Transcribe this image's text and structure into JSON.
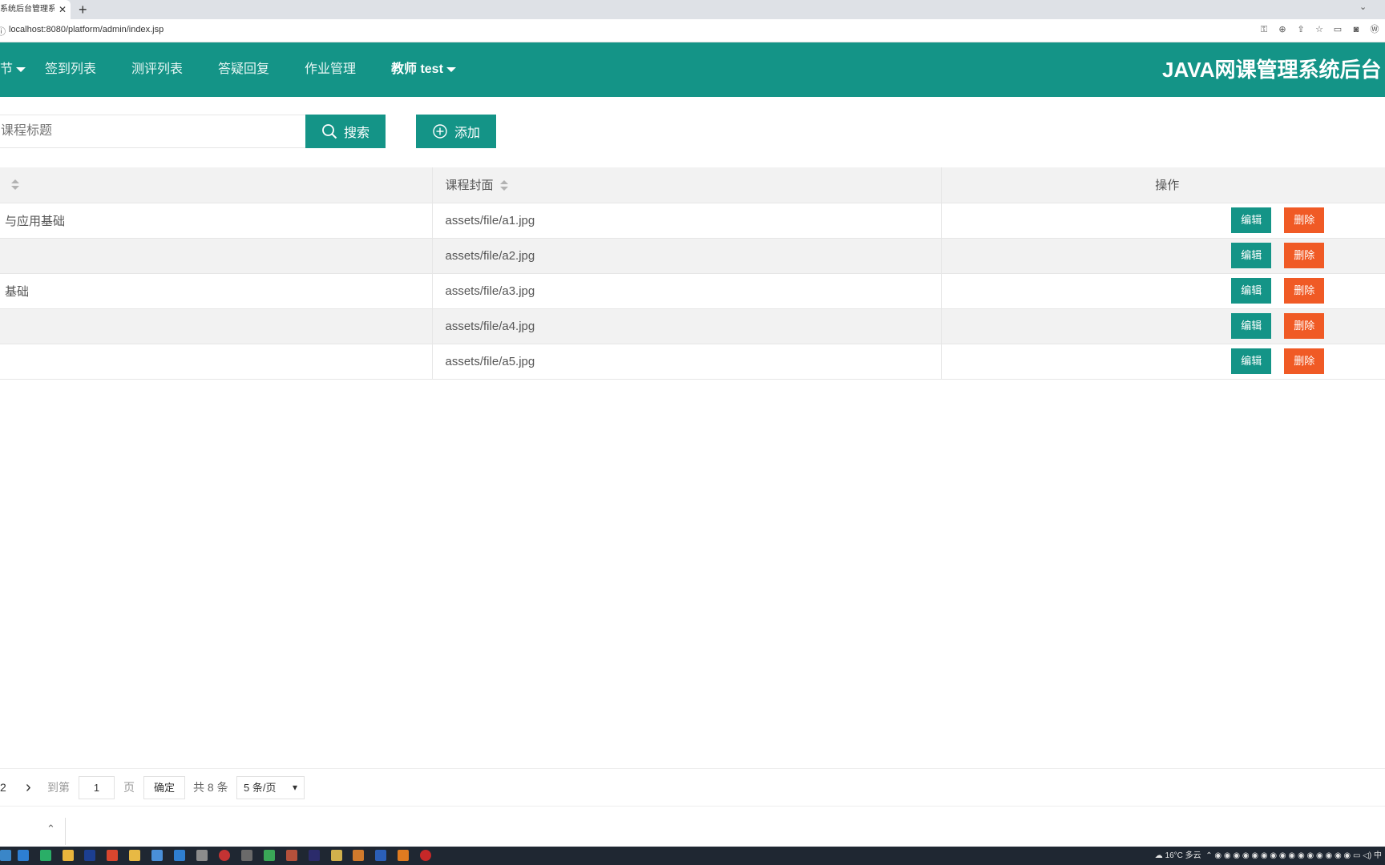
{
  "browser": {
    "tab_title": "系统后台管理系统",
    "tab_close": "✕",
    "new_tab": "+",
    "url": "localhost:8080/platform/admin/index.jsp"
  },
  "header": {
    "nav": [
      {
        "label": "节",
        "dropdown": true
      },
      {
        "label": "签到列表"
      },
      {
        "label": "测评列表"
      },
      {
        "label": "答疑回复"
      },
      {
        "label": "作业管理"
      },
      {
        "label": "教师 test",
        "dropdown": true
      }
    ],
    "app_title": "JAVA网课管理系统后台",
    "bg_color": "#149487"
  },
  "search": {
    "placeholder": "课程标题",
    "search_label": "搜索",
    "add_label": "添加"
  },
  "table": {
    "columns": [
      "",
      "课程封面",
      "操作"
    ],
    "rows": [
      {
        "title": "与应用基础",
        "cover": "assets/file/a1.jpg"
      },
      {
        "title": "",
        "cover": "assets/file/a2.jpg"
      },
      {
        "title": "基础",
        "cover": "assets/file/a3.jpg"
      },
      {
        "title": "",
        "cover": "assets/file/a4.jpg"
      },
      {
        "title": "",
        "cover": "assets/file/a5.jpg"
      }
    ],
    "edit_label": "编辑",
    "delete_label": "删除",
    "edit_color": "#149487",
    "delete_color": "#f05a25"
  },
  "pager": {
    "last_page": "2",
    "next": "›",
    "goto_label": "到第",
    "page_value": "1",
    "page_unit": "页",
    "confirm_label": "确定",
    "total": "共 8 条",
    "page_size": "5 条/页"
  },
  "taskbar": {
    "weather": "16°C 多云",
    "ime": "中"
  }
}
